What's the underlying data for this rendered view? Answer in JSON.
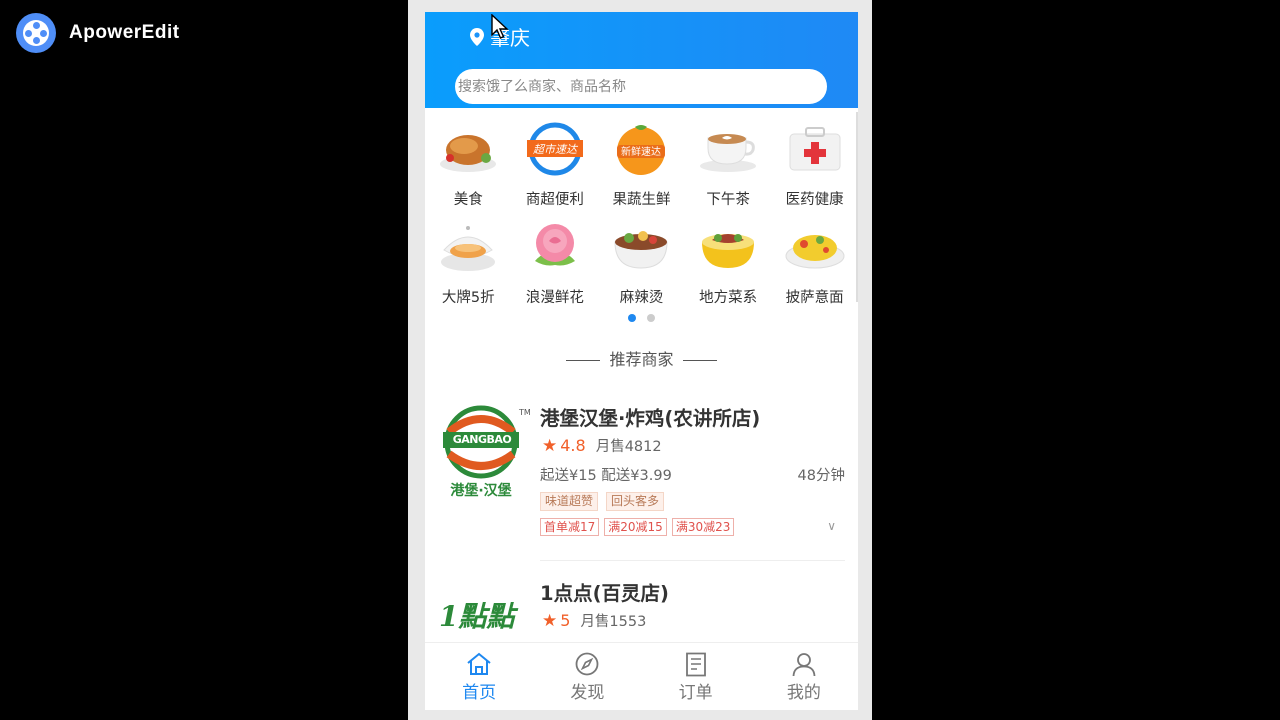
{
  "watermark": {
    "app_name": "ApowerEdit"
  },
  "header": {
    "location": "肇庆",
    "search_placeholder": "搜索饿了么商家、商品名称"
  },
  "categories": [
    [
      {
        "label": "美食",
        "icon": "roast-chicken-icon"
      },
      {
        "label": "商超便利",
        "icon": "supermarket-badge-icon"
      },
      {
        "label": "果蔬生鲜",
        "icon": "orange-fruit-icon"
      },
      {
        "label": "下午茶",
        "icon": "coffee-cup-icon"
      },
      {
        "label": "医药健康",
        "icon": "medicine-box-icon"
      }
    ],
    [
      {
        "label": "大牌5折",
        "icon": "cake-plate-icon"
      },
      {
        "label": "浪漫鲜花",
        "icon": "rose-icon"
      },
      {
        "label": "麻辣烫",
        "icon": "spicy-bowl-icon"
      },
      {
        "label": "地方菜系",
        "icon": "local-dish-bowl-icon"
      },
      {
        "label": "披萨意面",
        "icon": "pasta-plate-icon"
      }
    ]
  ],
  "carousel": {
    "pages": 2,
    "active_index": 0
  },
  "section": {
    "title": "推荐商家"
  },
  "shops": [
    {
      "name": "港堡汉堡·炸鸡(农讲所店)",
      "logo_text_top": "GANGBAO",
      "logo_text_bottom": "港堡·汉堡",
      "logo_tm": "TM",
      "score": "4.8",
      "sales": "月售4812",
      "fees": "起送¥15 配送¥3.99",
      "eta": "48分钟",
      "tags": [
        "味道超赞",
        "回头客多"
      ],
      "promos": [
        "首单减17",
        "满20减15",
        "满30减23"
      ]
    },
    {
      "name": "1点点(百灵店)",
      "logo_text": "1點點",
      "score": "5",
      "sales": "月售1553"
    }
  ],
  "tabbar": [
    {
      "label": "首页",
      "icon": "home-icon",
      "active": true
    },
    {
      "label": "发现",
      "icon": "compass-icon",
      "active": false
    },
    {
      "label": "订单",
      "icon": "order-list-icon",
      "active": false
    },
    {
      "label": "我的",
      "icon": "user-profile-icon",
      "active": false
    }
  ],
  "colors": {
    "header_blue": "#0a9dfc",
    "accent_blue": "#1e88f0",
    "star_orange": "#f1602a",
    "promo_red": "#e0524d"
  }
}
